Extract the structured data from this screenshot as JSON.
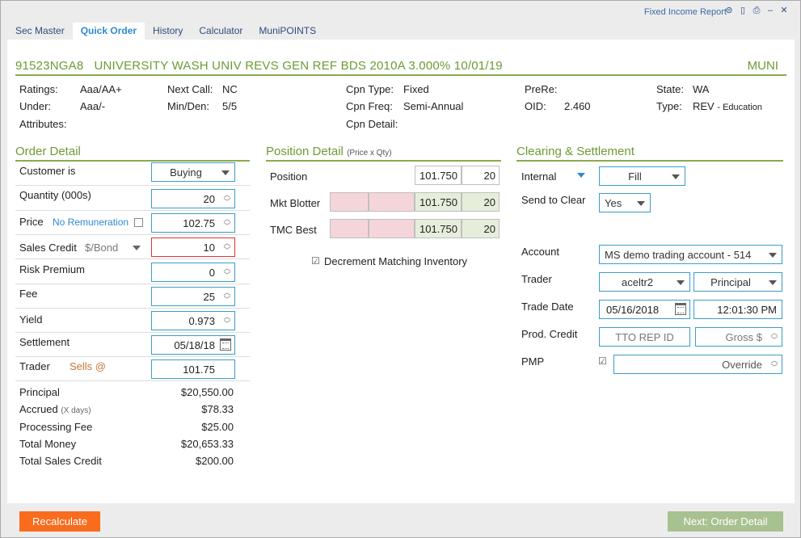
{
  "window": {
    "report_title": "Fixed Income Report"
  },
  "tabs": [
    "Sec Master",
    "Quick Order",
    "History",
    "Calculator",
    "MuniPOINTS"
  ],
  "security": {
    "headline": "91523NGA8   UNIVERSITY WASH UNIV REVS GEN REF BDS 2010A 3.000% 10/01/19",
    "type_tag": "MUNI",
    "ratings_label": "Ratings:",
    "ratings": "Aaa/AA+",
    "under_label": "Under:",
    "under": "Aaa/-",
    "attributes_label": "Attributes:",
    "next_call_label": "Next Call:",
    "next_call": "NC",
    "min_den_label": "Min/Den:",
    "min_den": "5/5",
    "cpn_type_label": "Cpn Type:",
    "cpn_type": "Fixed",
    "cpn_freq_label": "Cpn Freq:",
    "cpn_freq": "Semi-Annual",
    "cpn_detail_label": "Cpn Detail:",
    "prere_label": "PreRe:",
    "oid_label": "OID:",
    "oid": "2.460",
    "state_label": "State:",
    "state": "WA",
    "type_label": "Type:",
    "type": "REV",
    "type_detail": "- Education"
  },
  "order_detail": {
    "title": "Order Detail",
    "customer_label": "Customer is",
    "customer_value": "Buying",
    "quantity_label": "Quantity (000s)",
    "quantity": "20",
    "price_label": "Price",
    "no_remuneration": "No Remuneration",
    "price": "102.75",
    "sales_credit_label": "Sales Credit",
    "sales_credit_unit": "$/Bond",
    "sales_credit": "10",
    "risk_premium_label": "Risk Premium",
    "risk_premium": "0",
    "fee_label": "Fee",
    "fee": "25",
    "yield_label": "Yield",
    "yield": "0.973",
    "settlement_label": "Settlement",
    "settlement": "05/18/18",
    "trader_label": "Trader",
    "sells_at": "Sells @",
    "trader_price": "101.75",
    "principal_label": "Principal",
    "principal": "$20,550.00",
    "accrued_label": "Accrued",
    "accrued_note": "(X days)",
    "accrued": "$78.33",
    "processing_fee_label": "Processing Fee",
    "processing_fee": "$25.00",
    "total_money_label": "Total Money",
    "total_money": "$20,653.33",
    "total_sales_credit_label": "Total Sales Credit",
    "total_sales_credit": "$200.00"
  },
  "position_detail": {
    "title": "Position Detail",
    "subtitle": "(Price x Qty)",
    "rows": [
      {
        "label": "Position",
        "price": "101.750",
        "qty": "20"
      },
      {
        "label": "Mkt Blotter",
        "price": "101.750",
        "qty": "20"
      },
      {
        "label": "TMC Best",
        "price": "101.750",
        "qty": "20"
      }
    ],
    "decrement_label": "Decrement Matching Inventory"
  },
  "clearing": {
    "title": "Clearing & Settlement",
    "internal_label": "Internal",
    "fill_value": "Fill",
    "send_to_clear_label": "Send to Clear",
    "send_to_clear": "Yes",
    "account_label": "Account",
    "account": "MS demo trading account - 514",
    "trader_label": "Trader",
    "trader": "aceltr2",
    "capacity": "Principal",
    "trade_date_label": "Trade Date",
    "trade_date": "05/16/2018",
    "trade_time": "12:01:30 PM",
    "prod_credit_label": "Prod. Credit",
    "tto_placeholder": "TTO REP ID",
    "gross_placeholder": "Gross $",
    "pmp_label": "PMP",
    "override_placeholder": "Override"
  },
  "buttons": {
    "recalculate": "Recalculate",
    "next": "Next: Order Detail"
  },
  "colors": {
    "accent_green": "#6e9a34",
    "tab_active": "#2f8ad0",
    "recalc_orange": "#f96c1e",
    "next_disabled": "#a8c190",
    "field_border": "#3b9dc8"
  }
}
